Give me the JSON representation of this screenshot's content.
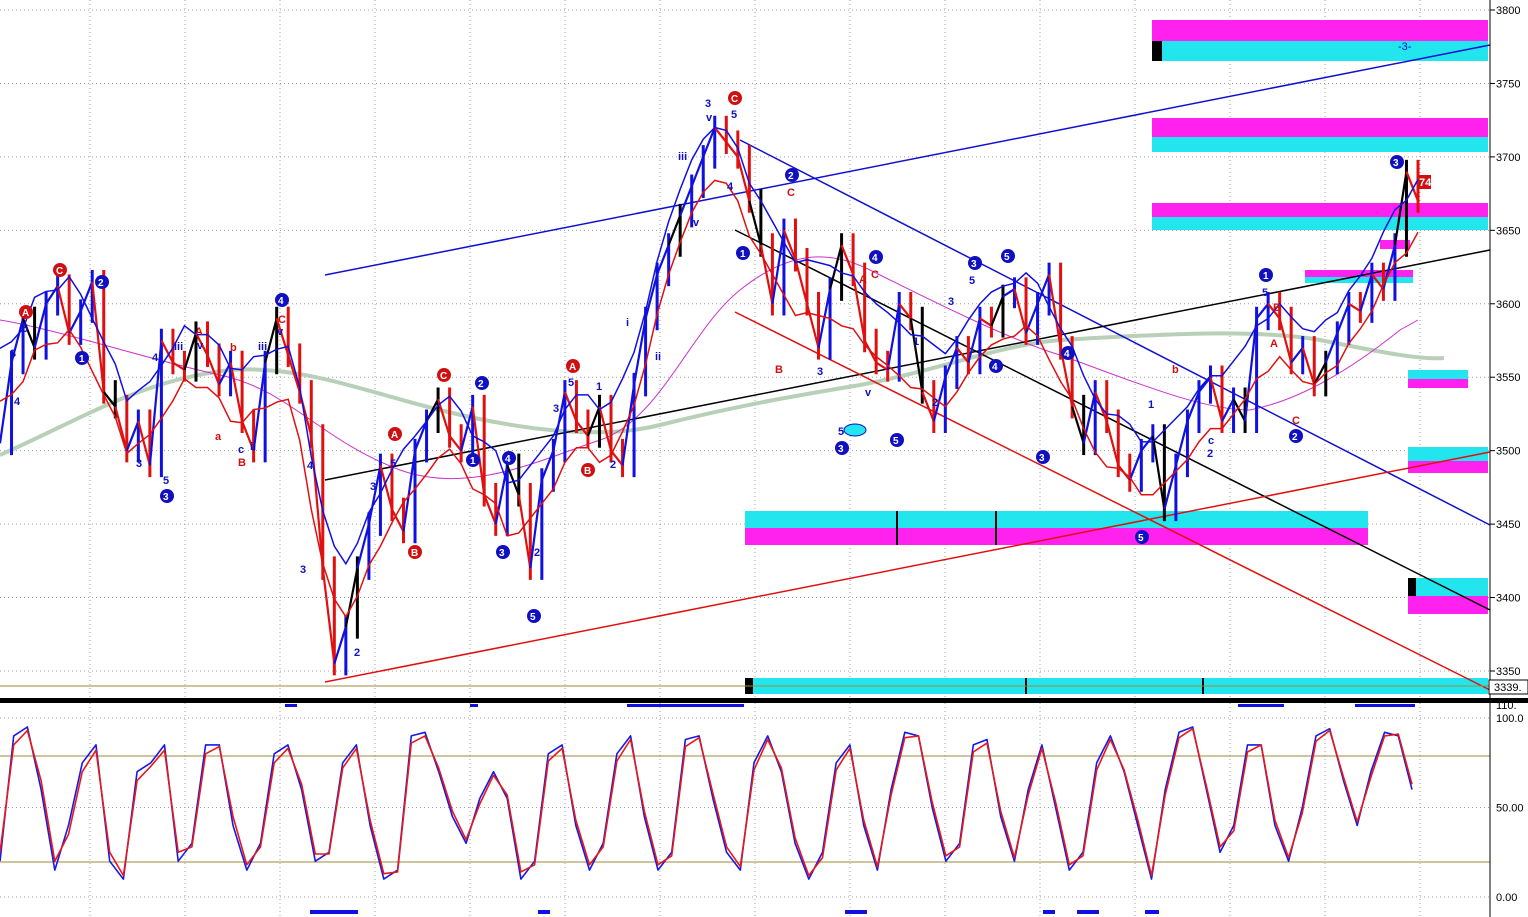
{
  "colors": {
    "background": "#ffffff",
    "grid": "#9aa0a6",
    "up_leg": "#1010e0",
    "down_leg": "#e01010",
    "neutral": "#000000",
    "ma_grey": "#b8d0b8",
    "ma_magenta": "#cc33cc",
    "cyan": "#22e5ee",
    "magenta": "#ff22ee",
    "stoch_k": "#1818e8",
    "stoch_d": "#e81818",
    "stoch_ref": "#a08a3a"
  },
  "chart_data": [
    {
      "type": "line",
      "panel": "price",
      "y_ticks": [
        "3800",
        "3750",
        "3700",
        "3650",
        "3600",
        "3550",
        "3500",
        "3450",
        "3400",
        "3350"
      ],
      "ylim": [
        3335,
        3802
      ],
      "last_price_label": "3339.",
      "annotations": [
        "-3-",
        "74PTI"
      ],
      "wave_labels": {
        "blue": [
          "1",
          "2",
          "3",
          "4",
          "5",
          "i",
          "ii",
          "iii",
          "iv",
          "v",
          "c"
        ],
        "red": [
          "A",
          "B",
          "C",
          "a",
          "b",
          "c",
          "2"
        ]
      },
      "series": [
        {
          "values": [
            3505,
            3560,
            3590,
            3570,
            3600,
            3612,
            3580,
            3595,
            3615,
            3540,
            3530,
            3500,
            3520,
            3490,
            3575,
            3560,
            3555,
            3580,
            3565,
            3545,
            3560,
            3520,
            3500,
            3560,
            3590,
            3565,
            3540,
            3510,
            3420,
            3355,
            3380,
            3420,
            3450,
            3490,
            3460,
            3445,
            3500,
            3520,
            3535,
            3510,
            3500,
            3530,
            3470,
            3450,
            3490,
            3470,
            3420,
            3480,
            3500,
            3540,
            3520,
            3510,
            3530,
            3500,
            3490,
            3545,
            3590,
            3620,
            3640,
            3660,
            3680,
            3700,
            3720,
            3710,
            3700,
            3670,
            3640,
            3600,
            3650,
            3630,
            3600,
            3570,
            3610,
            3640,
            3620,
            3575,
            3560,
            3555,
            3600,
            3590,
            3540,
            3520,
            3550,
            3570,
            3560,
            3590,
            3585,
            3605,
            3610,
            3580,
            3600,
            3620,
            3570,
            3530,
            3505,
            3540,
            3520,
            3490,
            3480,
            3500,
            3510,
            3460,
            3490,
            3520,
            3540,
            3550,
            3520,
            3535,
            3520,
            3590,
            3600,
            3590,
            3560,
            3570,
            3545,
            3560,
            3580,
            3600,
            3595,
            3620,
            3610,
            3640,
            3690,
            3670
          ]
        }
      ],
      "levels": [
        {
          "kind": "channel-top",
          "color": "#1010d0"
        },
        {
          "kind": "channel-bottom",
          "color": "#e01010"
        },
        {
          "kind": "midline",
          "color": "#000000"
        }
      ]
    },
    {
      "type": "line",
      "panel": "stochastic",
      "y_ticks": [
        "100.0",
        "50.00",
        "0.00"
      ],
      "top_label": "110.",
      "ylim": [
        -5,
        112
      ],
      "ref_levels": [
        80,
        20
      ],
      "series": [
        {
          "values": [
            20,
            90,
            95,
            60,
            15,
            40,
            75,
            85,
            20,
            10,
            70,
            75,
            85,
            20,
            30,
            85,
            85,
            40,
            15,
            30,
            80,
            85,
            60,
            20,
            25,
            75,
            85,
            40,
            10,
            15,
            90,
            92,
            70,
            45,
            30,
            55,
            70,
            55,
            10,
            20,
            80,
            85,
            40,
            15,
            30,
            80,
            90,
            45,
            15,
            25,
            88,
            90,
            55,
            25,
            15,
            75,
            90,
            70,
            30,
            10,
            25,
            75,
            85,
            40,
            15,
            60,
            92,
            90,
            50,
            20,
            30,
            85,
            88,
            45,
            20,
            60,
            85,
            50,
            15,
            25,
            75,
            90,
            70,
            40,
            10,
            60,
            92,
            95,
            60,
            25,
            40,
            85,
            85,
            40,
            20,
            50,
            90,
            94,
            65,
            40,
            70,
            92,
            90,
            60
          ]
        },
        {
          "values": [
            25,
            85,
            93,
            65,
            20,
            35,
            70,
            82,
            25,
            12,
            65,
            73,
            82,
            25,
            28,
            80,
            84,
            45,
            18,
            28,
            75,
            83,
            63,
            24,
            24,
            72,
            83,
            43,
            13,
            14,
            86,
            90,
            72,
            48,
            32,
            52,
            68,
            57,
            14,
            18,
            76,
            83,
            43,
            18,
            28,
            76,
            88,
            48,
            18,
            23,
            84,
            89,
            58,
            28,
            17,
            71,
            88,
            72,
            33,
            12,
            22,
            71,
            83,
            43,
            17,
            57,
            89,
            90,
            53,
            23,
            28,
            81,
            86,
            48,
            22,
            57,
            83,
            53,
            18,
            23,
            71,
            88,
            71,
            43,
            12,
            57,
            89,
            94,
            62,
            28,
            37,
            81,
            85,
            43,
            22,
            47,
            87,
            93,
            67,
            42,
            67,
            90,
            91,
            63
          ]
        }
      ]
    }
  ]
}
